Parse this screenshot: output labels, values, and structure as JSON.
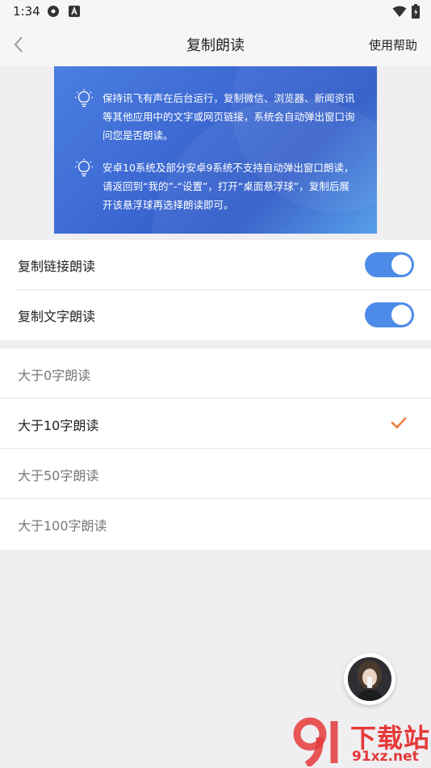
{
  "status_bar": {
    "time": "1:34"
  },
  "nav": {
    "title": "复制朗读",
    "help": "使用帮助"
  },
  "banner": {
    "tips": [
      "保持讯飞有声在后台运行，复制微信、浏览器、新闻资讯等其他应用中的文字或网页链接，系统会自动弹出窗口询问您是否朗读。",
      "安卓10系统及部分安卓9系统不支持自动弹出窗口朗读，请返回到“我的”-“设置”，打开“桌面悬浮球”，复制后展开该悬浮球再选择朗读即可。"
    ]
  },
  "toggles": [
    {
      "label": "复制链接朗读",
      "on": true
    },
    {
      "label": "复制文字朗读",
      "on": true
    }
  ],
  "options": [
    {
      "label": "大于0字朗读",
      "selected": false
    },
    {
      "label": "大于10字朗读",
      "selected": true
    },
    {
      "label": "大于50字朗读",
      "selected": false
    },
    {
      "label": "大于100字朗读",
      "selected": false
    }
  ],
  "watermark": {
    "line1": "下载站",
    "line2": "91xz.net"
  },
  "colors": {
    "accent": "#4d8be8",
    "check": "#f07c3c",
    "banner": "#3b67d2"
  }
}
